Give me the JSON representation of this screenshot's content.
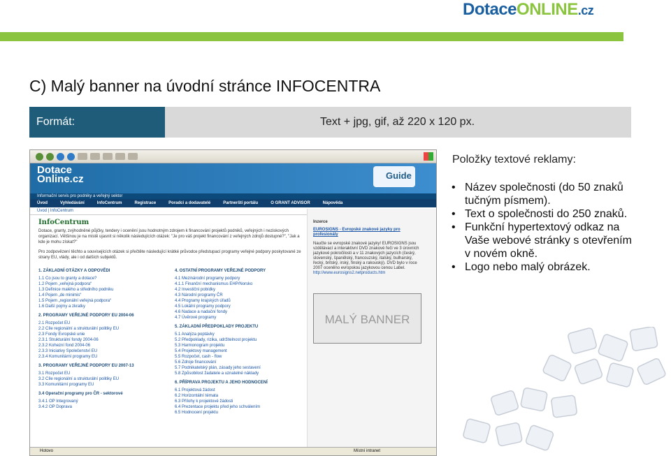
{
  "logo": {
    "part1": "Dotace",
    "part2": "ONLINE",
    "part3": ".cz",
    "blue": "#1a5fa0",
    "green": "#8bc53f"
  },
  "title": "C) Malý banner na úvodní stránce INFOCENTRA",
  "format": {
    "label": "Formát:",
    "value": "Text + jpg, gif, až 220 x 120 px.",
    "label_bg": "#1f5c7a"
  },
  "screenshot": {
    "site_title_1": "Dotace",
    "site_title_2": "Online.cz",
    "guide": "Guide",
    "strap": "Informační servis pro podniky a veřejný sektor",
    "nav": [
      "Úvod",
      "Vyhledávání",
      "InfoCentrum",
      "Registrace",
      "Poradci a dodavatelé",
      "Partnerští portálu",
      "O GRANT ADVISOR",
      "Nápověda"
    ],
    "breadcrumb": "Úvod  |  InfoCentrum",
    "section_title": "InfoCentrum",
    "intro": "Dotace, granty, zvýhodněné půjčky, tendery i ocenění jsou hodnotným zdrojem k financování projektů podniků, veřejných i neziskových organizací. Většinou je na místě ujasnit si několik následujících otázek: \"Je pro váš projekt financování z veřejných zdrojů dostupné?\", \"Jak a kde je mohu získat?\"",
    "intro2": "Pro zodpovězení těchto a souvisejících otázek si přečtěte následující krátké průvodce předstupací programy veřejné podpory poskytované ze strany EU, vlády, ale i od dalších subjektů.",
    "left_sections": [
      {
        "title": "1. ZÁKLADNÍ OTÁZKY A ODPOVĚDI",
        "items": [
          "1.1 Co jsou to granty a dotace?",
          "1.2 Pojem „veřejná podpora“",
          "1.3 Definice malého a středního podniku",
          "1.4 Pojem „de minimis“",
          "1.5 Pojem „regionální veřejná podpora“",
          "1.6 Další pojmy a zkratky"
        ]
      },
      {
        "title": "2. PROGRAMY VEŘEJNÉ PODPORY EU 2004-06",
        "items": [
          "2.1 Rozpočet EU",
          "2.2 Cíle regionální a strukturální politiky EU",
          "2.3 Fondy Evropské unie",
          "2.3.1 Strukturální fondy 2004-06",
          "2.3.2 Kohezní fond 2004-06",
          "2.3.3 Iniciativy Společenství EU",
          "2.3.4 Komunitární programy EU"
        ]
      },
      {
        "title": "3. PROGRAMY VEŘEJNÉ PODPORY EU 2007-13",
        "items": [
          "3.1 Rozpočet EU",
          "3.2 Cíle regionální a strukturální politiky EU",
          "3.3 Komunitární programy EU"
        ]
      },
      {
        "title": "3.4 Operační programy pro ČR - sektorové",
        "items": [
          "3.4.1 OP Integrovaný",
          "3.4.2 OP Doprava"
        ]
      }
    ],
    "right_sections": [
      {
        "title": "4. OSTATNÍ PROGRAMY VEŘEJNÉ PODPORY",
        "items": [
          "4.1 Mezinárodní programy podpory",
          "4.1.1 Finanční mechanismus EHP/Norsko",
          "4.2 Investiční pobídky",
          "4.3 Národní programy ČR",
          "4.4 Programy krajských úřadů",
          "4.5 Lokální programy podpory",
          "4.6 Nadace a nadační fondy",
          "4.7 Úvěrové programy"
        ]
      },
      {
        "title": "5. ZÁKLADNÍ PŘEDPOKLADY PROJEKTU",
        "items": [
          "5.1 Analýza poptávky",
          "5.2 Předpoklady, rizika, udržitelnost projektu",
          "5.3 Harmonogram projektu",
          "5.4 Projektový management",
          "5.5 Rozpočet, cash - flow",
          "5.6 Zdroje financování",
          "5.7 Podnikatelský plán, zásady jeho sestavení",
          "5.8 Způsobilost žadatele a uznatelné náklady"
        ]
      },
      {
        "title": "6. PŘÍPRAVA PROJEKTU A JEHO HODNOCENÍ",
        "items": [
          "6.1 Projektová žádost",
          "6.2 Horizontální témata",
          "6.3 Přílohy k projektové žádosti",
          "6.4 Prezentace projektu před jeho schválením",
          "6.5 Hodnocení projektu"
        ]
      }
    ],
    "ad_header": "Inzerce",
    "ad_title": "EUROSIGNS - Evropské znakové jazyky pro profesionály",
    "ad_text": "Naučte se evropské znakové jazyky! EUROSIGNS jsou vzdělávací a interaktivní DVD znakové řeči ve 3 úrovních jazykové pokročilosti a v 11 znakových jazycích (český, slovenský, španělský, francouzský, italský, bulharský, řecký, britský, irský, finský a rakouský). DVD bylo v roce 2007 oceněno evropskou jazykovou cenou Label.",
    "ad_link": "http://www.eurosigns2.netproducts.htm",
    "banner": "MALÝ BANNER",
    "status_left": "Hotovo",
    "status_right": "Místní intranet"
  },
  "right_panel": {
    "title": "Položky textové reklamy:",
    "items": [
      "Název společnosti (do 50 znaků tučným písmem).",
      "Text o společnosti do 250 znaků.",
      "Funkční hypertextový odkaz na Vaše webové stránky s otevřením v novém okně.",
      "Logo nebo malý obrázek."
    ]
  },
  "accent_green": "#8bc53f"
}
